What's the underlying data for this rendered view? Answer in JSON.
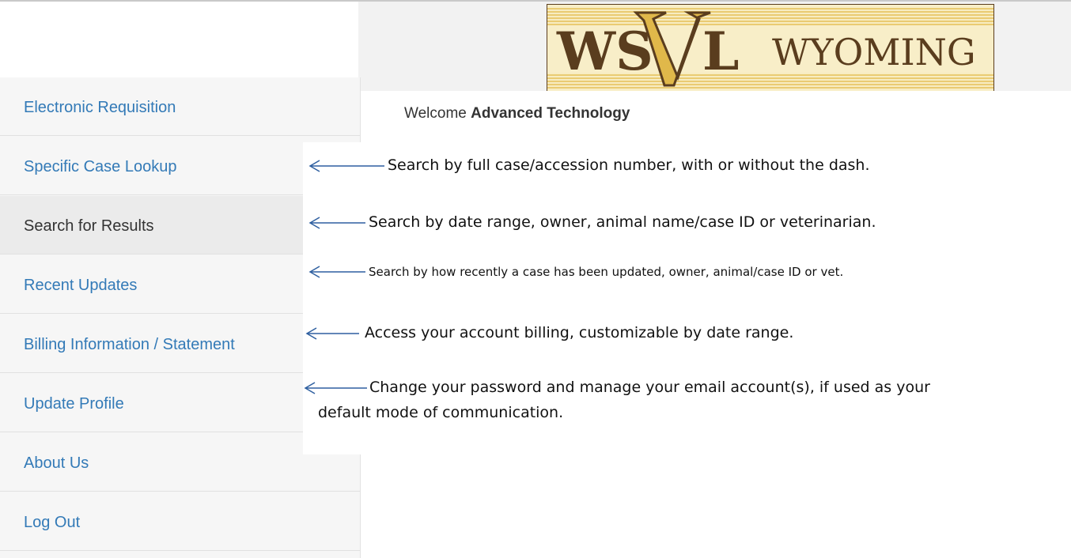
{
  "logo": {
    "mark": "WSVL",
    "wordmark": "WYOMING"
  },
  "welcome": {
    "greeting": "Welcome",
    "user": "Advanced Technology"
  },
  "nav": {
    "items": [
      {
        "label": "Electronic Requisition"
      },
      {
        "label": "Specific Case Lookup"
      },
      {
        "label": "Search for Results"
      },
      {
        "label": "Recent Updates"
      },
      {
        "label": "Billing Information / Statement"
      },
      {
        "label": "Update Profile"
      },
      {
        "label": "About Us"
      },
      {
        "label": "Log Out"
      }
    ],
    "active_index": 2
  },
  "annotations": [
    {
      "text": "Search by full case/accession number, with or without the dash."
    },
    {
      "text": "Search by date range, owner, animal name/case ID or veterinarian."
    },
    {
      "text": "Search by how recently a case has been updated, owner, animal/case ID or vet."
    },
    {
      "text": "Access your account billing, customizable by date range."
    },
    {
      "line1": "Change your password and manage your email account(s), if used as your",
      "line2": "default mode of communication."
    }
  ],
  "colors": {
    "nav_link": "#337ab7",
    "nav_active_text": "#333333",
    "logo_brown": "#5a3d1e",
    "logo_gold": "#e0b84a",
    "arrow": "#2e5fa0"
  }
}
